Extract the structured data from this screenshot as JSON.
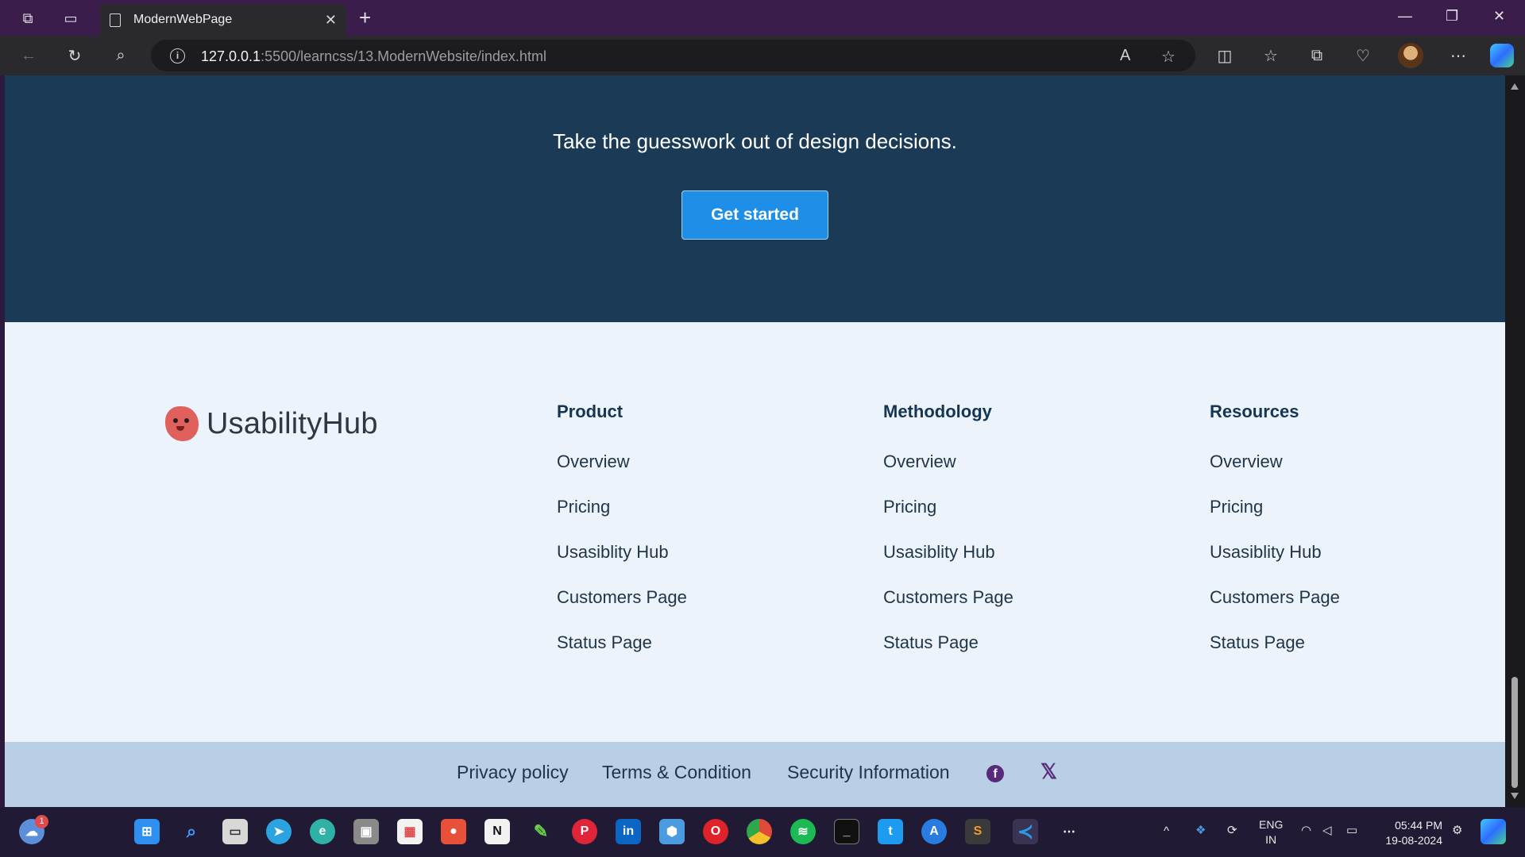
{
  "browser": {
    "tab_title": "ModernWebPage",
    "tab_close": "✕",
    "new_tab": "+",
    "url_host": "127.0.0.1",
    "url_rest": ":5500/learncss/13.ModernWebsite/index.html"
  },
  "cta": {
    "text": "Take the guesswork out of design decisions.",
    "button": "Get started"
  },
  "footer": {
    "logo_text": "UsabilityHub",
    "columns": [
      {
        "title": "Product",
        "links": [
          "Overview",
          "Pricing",
          "Usasiblity Hub",
          "Customers Page",
          "Status Page"
        ]
      },
      {
        "title": "Methodology",
        "links": [
          "Overview",
          "Pricing",
          "Usasiblity Hub",
          "Customers Page",
          "Status Page"
        ]
      },
      {
        "title": "Resources",
        "links": [
          "Overview",
          "Pricing",
          "Usasiblity Hub",
          "Customers Page",
          "Status Page"
        ]
      }
    ],
    "bottom_links": [
      "Privacy policy",
      "Terms & Condition",
      "Security Information"
    ]
  },
  "taskbar": {
    "notification_count": "1",
    "language_line1": "ENG",
    "language_line2": "IN",
    "time": "05:44 PM",
    "date": "19-08-2024"
  },
  "colors": {
    "cta_bg": "#1a3a55",
    "button_blue": "#1f8ee6",
    "footer_bg": "#edf3fb",
    "bottom_bar_bg": "#b8cfe6",
    "title_bar": "#3a1d4b"
  },
  "icons": [
    "workspaces-icon",
    "tab-actions-icon",
    "page-icon",
    "back-icon",
    "refresh-icon",
    "search-icon",
    "info-icon",
    "read-aloud-icon",
    "favorite-star-icon",
    "split-screen-icon",
    "favorites-icon",
    "collections-icon",
    "browser-essentials-icon",
    "profile-avatar",
    "more-icon",
    "copilot-icon",
    "facebook-icon",
    "x-icon"
  ]
}
